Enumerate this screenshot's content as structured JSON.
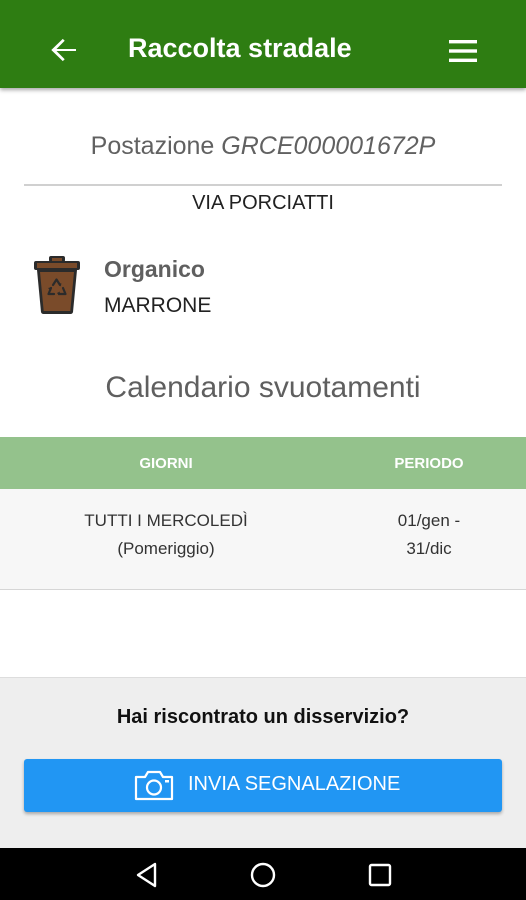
{
  "appbar": {
    "title": "Raccolta stradale",
    "back_icon": "arrow-back-icon",
    "menu_icon": "hamburger-menu-icon",
    "color": "#2e7d12"
  },
  "station": {
    "prefix": "Postazione",
    "code": "GRCE000001672P",
    "street": "VIA PORCIATTI"
  },
  "container": {
    "icon": "recycle-bin-icon",
    "type": "Organico",
    "color_label": "MARRONE"
  },
  "calendar": {
    "title": "Calendario svuotamenti",
    "columns": [
      "GIORNI",
      "PERIODO"
    ],
    "header_color": "#94c28c",
    "rows": [
      {
        "days_line1": "TUTTI I MERCOLEDÌ",
        "days_line2": "(Pomeriggio)",
        "period_line1": "01/gen -",
        "period_line2": "31/dic"
      }
    ]
  },
  "footer": {
    "question": "Hai riscontrato un disservizio?",
    "button_label": "INVIA SEGNALAZIONE",
    "button_icon": "camera-icon",
    "button_color": "#2196f3"
  },
  "navbar": {
    "icons": [
      "nav-back-icon",
      "nav-home-icon",
      "nav-recents-icon"
    ]
  }
}
